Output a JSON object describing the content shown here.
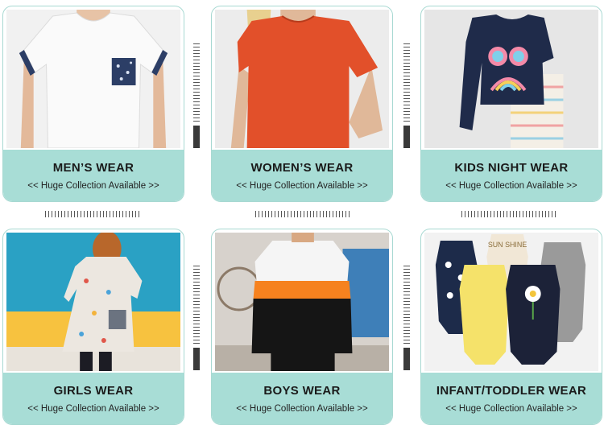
{
  "categories": [
    {
      "title": "MEN’S WEAR",
      "subtitle": "<< Huge Collection Available >>"
    },
    {
      "title": "WOMEN’S WEAR",
      "subtitle": "<< Huge Collection Available >>"
    },
    {
      "title": "KIDS NIGHT WEAR",
      "subtitle": "<< Huge Collection Available >>"
    },
    {
      "title": "GIRLS WEAR",
      "subtitle": "<< Huge Collection Available >>"
    },
    {
      "title": "BOYS WEAR",
      "subtitle": "<< Huge Collection Available >>"
    },
    {
      "title": "INFANT/TODDLER WEAR",
      "subtitle": "<< Huge Collection Available >>"
    }
  ],
  "colors": {
    "caption_bg": "#a8ddd6",
    "border": "#a8d9d2",
    "title_text": "#1a1a1a"
  },
  "images": {
    "mens": "white t-shirt with patterned pocket",
    "womens": "orange-red women's top",
    "kids": "navy pajama set with heart glasses and rainbow",
    "girls": "girl in floral print dress",
    "boys": "boy in white orange black sweatshirt",
    "infant": "set of baby bodysuits"
  },
  "infant_image_text": "SUN SHINE"
}
